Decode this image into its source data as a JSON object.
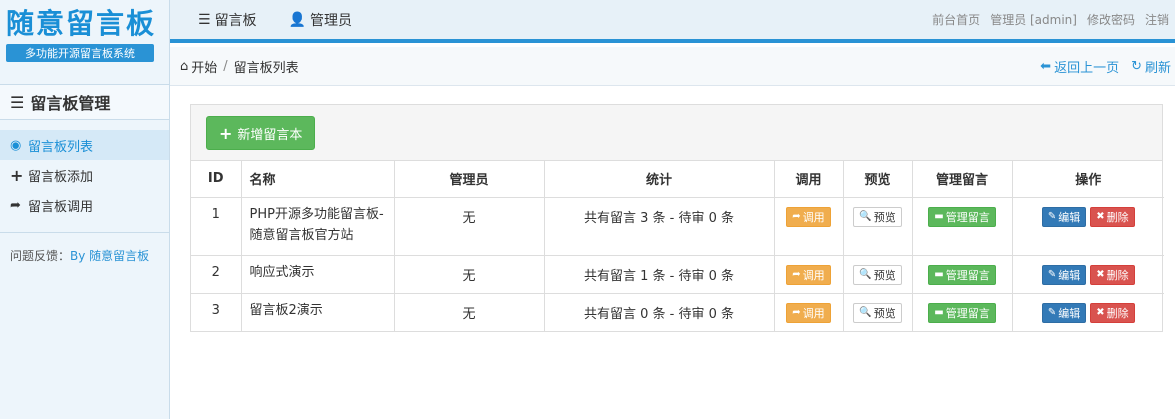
{
  "sidebar": {
    "logo_title": "随意留言板",
    "logo_subtitle": "多功能开源留言板系统",
    "header": "留言板管理",
    "items": [
      {
        "label": "留言板列表",
        "icon": "globe-icon",
        "active": true
      },
      {
        "label": "留言板添加",
        "icon": "plus-icon",
        "active": false
      },
      {
        "label": "留言板调用",
        "icon": "share-icon",
        "active": false
      }
    ],
    "feedback_label": "问题反馈：",
    "feedback_link": "By 随意留言板"
  },
  "topbar": {
    "nav": [
      {
        "label": "留言板",
        "icon": "list-icon"
      },
      {
        "label": "管理员",
        "icon": "user-icon"
      }
    ],
    "links": [
      "前台首页",
      "管理员 [admin]",
      "修改密码",
      "注销"
    ]
  },
  "breadcrumb": {
    "home": "开始",
    "separator": "/",
    "current": "留言板列表",
    "back": "返回上一页",
    "refresh": "刷新"
  },
  "panel": {
    "add_button": "新增留言本"
  },
  "table": {
    "headers": [
      "ID",
      "名称",
      "管理员",
      "统计",
      "调用",
      "预览",
      "管理留言",
      "操作"
    ],
    "rows": [
      {
        "id": "1",
        "name": "PHP开源多功能留言板-随意留言板官方站",
        "admin": "无",
        "stats": "共有留言 3 条 - 待审 0 条"
      },
      {
        "id": "2",
        "name": "响应式演示",
        "admin": "无",
        "stats": "共有留言 1 条 - 待审 0 条"
      },
      {
        "id": "3",
        "name": "留言板2演示",
        "admin": "无",
        "stats": "共有留言 0 条 - 待审 0 条"
      }
    ],
    "actions": {
      "call": "调用",
      "preview": "预览",
      "manage": "管理留言",
      "edit": "编辑",
      "delete": "删除"
    }
  },
  "colors": {
    "accent": "#2a93d5",
    "success": "#5cb85c",
    "warning": "#f0ad4e",
    "primary": "#337ab7",
    "danger": "#d9534f"
  }
}
